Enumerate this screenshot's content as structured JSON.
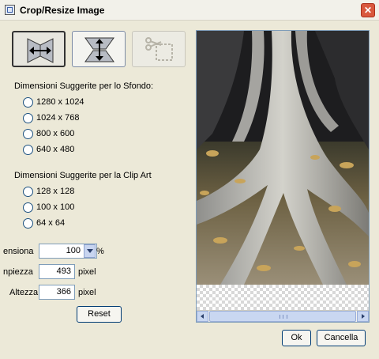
{
  "window": {
    "title": "Crop/Resize Image",
    "close_glyph": "✕"
  },
  "toolbar": {
    "buttons": [
      {
        "name": "horizontal-resize",
        "icon": "arrows-horizontal-icon",
        "state": "selected"
      },
      {
        "name": "vertical-resize",
        "icon": "arrows-vertical-icon",
        "state": "normal"
      },
      {
        "name": "crop",
        "icon": "crop-scissors-icon",
        "state": "disabled"
      }
    ]
  },
  "wallpaper": {
    "label": "Dimensioni Suggerite per lo Sfondo:",
    "options": [
      "1280 x 1024",
      "1024 x 768",
      "800 x 600",
      "640 x 480"
    ]
  },
  "clipart": {
    "label": "Dimensioni Suggerite per la Clip Art",
    "options": [
      "128 x 128",
      "100 x 100",
      "64 x 64"
    ]
  },
  "scale": {
    "label": "ensiona",
    "value": "100",
    "unit": "%"
  },
  "width": {
    "label": "npiezza",
    "value": "493",
    "unit": "pixel"
  },
  "height": {
    "label": "Altezza",
    "value": "366",
    "unit": "pixel"
  },
  "buttons": {
    "reset": "Reset",
    "ok": "Ok",
    "cancel": "Cancella"
  },
  "preview": {
    "scrollbar_grip": "|||"
  },
  "colors": {
    "window_bg": "#ece9d8",
    "accent": "#7f9db9",
    "close": "#d9583e"
  }
}
